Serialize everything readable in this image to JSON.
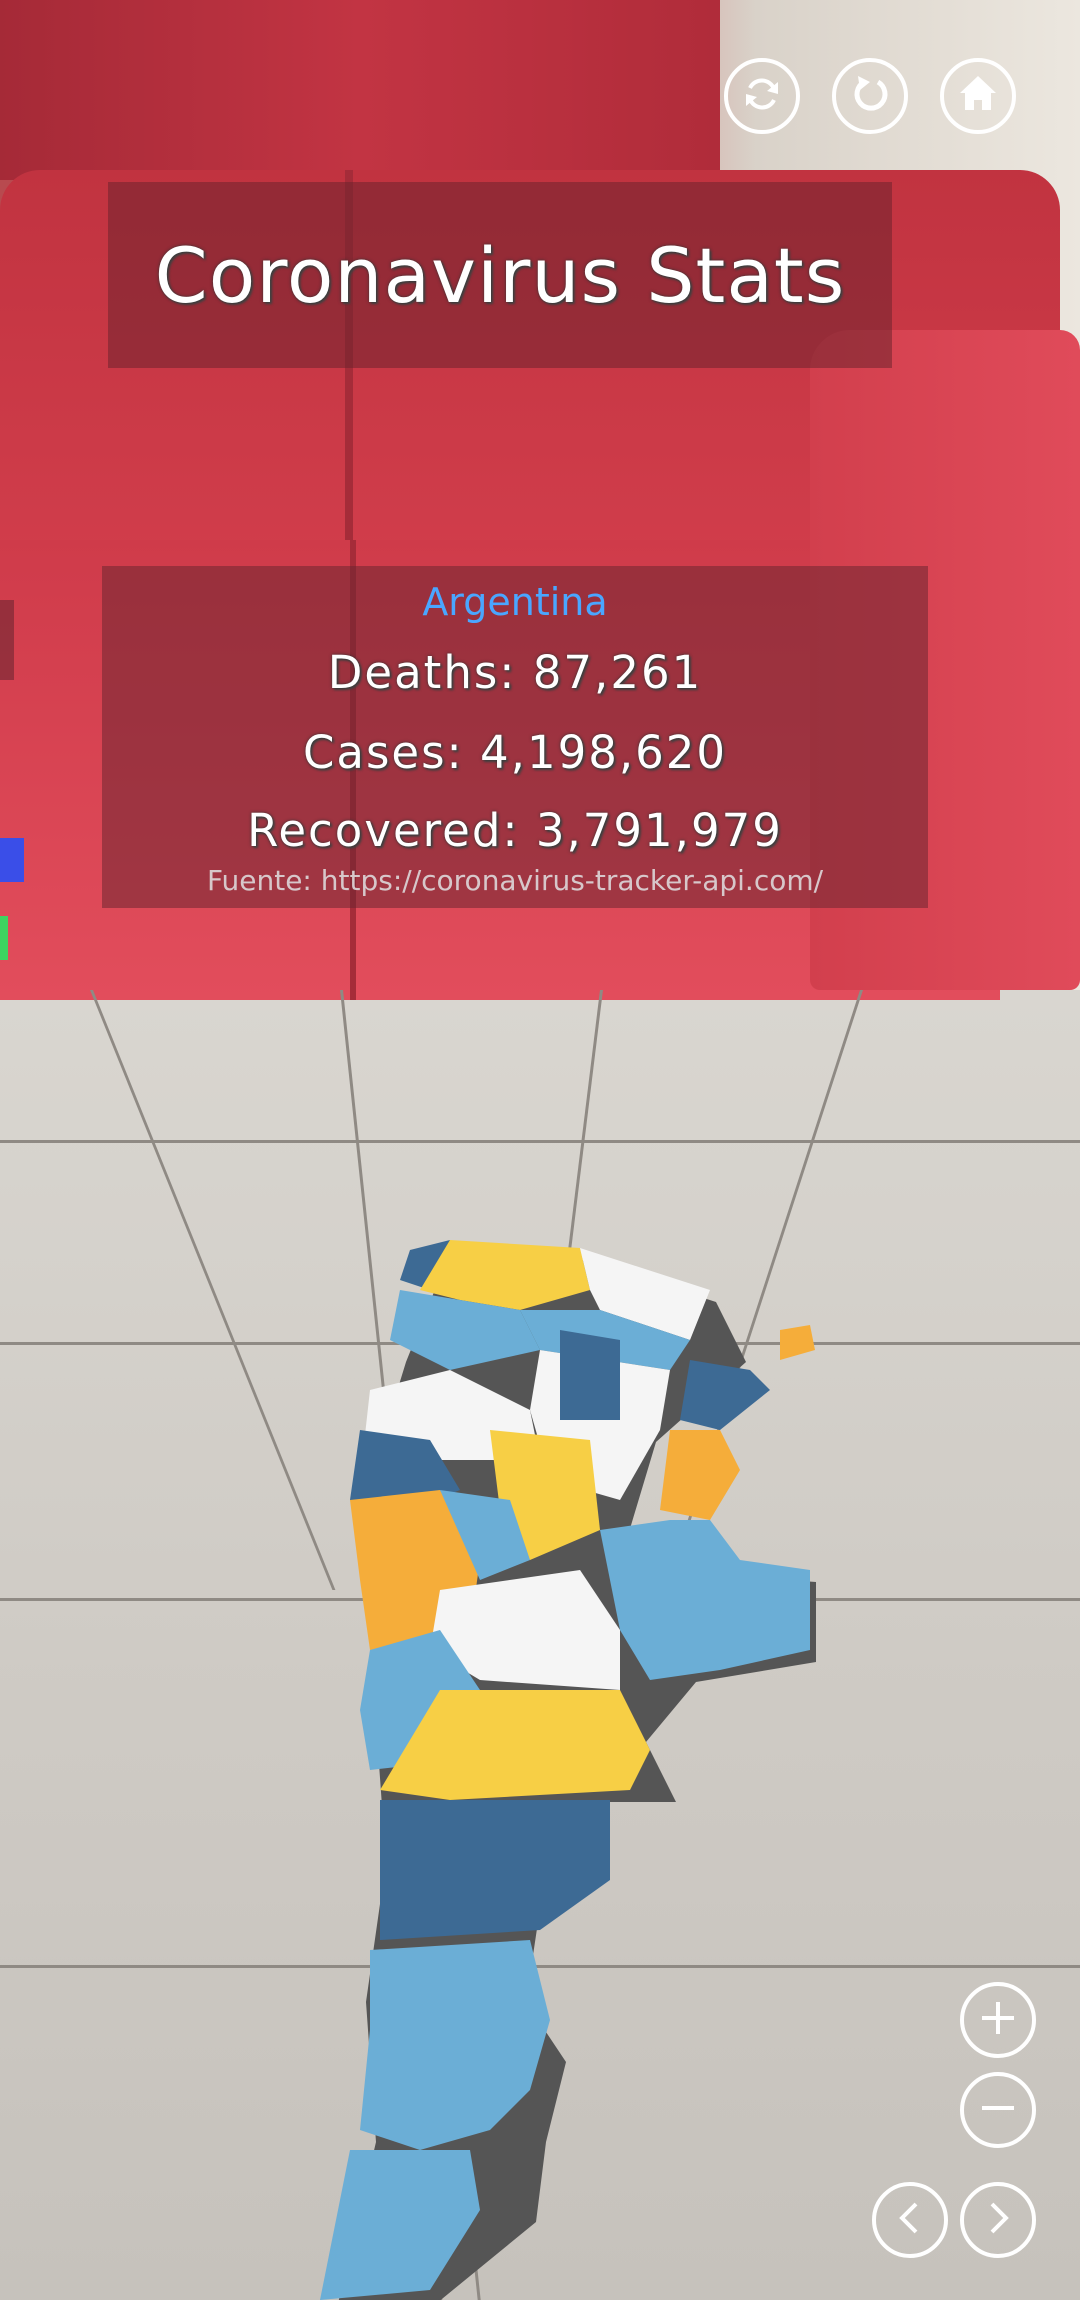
{
  "toolbar": {
    "refresh_icon": "refresh-icon",
    "reset_icon": "reset-icon",
    "home_icon": "home-icon"
  },
  "title": "Coronavirus Stats",
  "stats": {
    "country": "Argentina",
    "deaths": "Deaths: 87,261",
    "cases": "Cases: 4,198,620",
    "recovered": "Recovered: 3,791,979",
    "source": "Fuente: https://coronavirus-tracker-api.com/"
  },
  "controls": {
    "zoom_in_icon": "plus-icon",
    "zoom_out_icon": "minus-icon",
    "prev_icon": "chevron-left-icon",
    "next_icon": "chevron-right-icon"
  },
  "colors": {
    "map_dark_blue": "#3d6a94",
    "map_light_blue": "#6baed6",
    "map_yellow": "#f7cf45",
    "map_orange": "#f5ad3a",
    "map_white": "#f5f5f5",
    "country_label": "#4aa6ff"
  }
}
